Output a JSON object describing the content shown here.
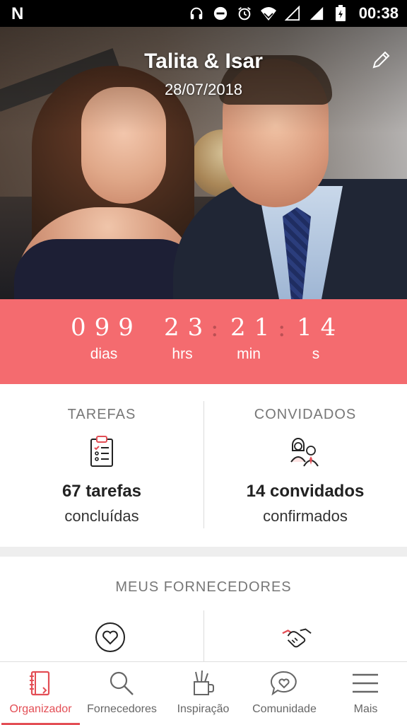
{
  "status_bar": {
    "notification": "N",
    "time": "00:38"
  },
  "header": {
    "couple_names": "Talita & Isar",
    "wedding_date": "28/07/2018"
  },
  "countdown": {
    "days": "099",
    "hours": "23",
    "minutes": "21",
    "seconds": "14",
    "labels": {
      "days": "dias",
      "hours": "hrs",
      "minutes": "min",
      "seconds": "s"
    }
  },
  "stats": {
    "tasks": {
      "title": "TAREFAS",
      "count": "67 tarefas",
      "subtitle": "concluídas",
      "icon": "checklist-clipboard-icon"
    },
    "guests": {
      "title": "CONVIDADOS",
      "count": "14 convidados",
      "subtitle": "confirmados",
      "icon": "couple-guests-icon"
    }
  },
  "vendors": {
    "title": "MEUS FORNECEDORES",
    "items": [
      {
        "icon": "heart-circle-icon"
      },
      {
        "icon": "handshake-icon"
      }
    ]
  },
  "bottom_nav": {
    "items": [
      {
        "label": "Organizador",
        "icon": "notebook-icon",
        "active": true
      },
      {
        "label": "Fornecedores",
        "icon": "search-icon",
        "active": false
      },
      {
        "label": "Inspiração",
        "icon": "pencil-cup-icon",
        "active": false
      },
      {
        "label": "Comunidade",
        "icon": "chat-heart-icon",
        "active": false
      },
      {
        "label": "Mais",
        "icon": "menu-icon",
        "active": false
      }
    ]
  },
  "colors": {
    "accent": "#f46b6f",
    "active_nav": "#e34e55"
  }
}
